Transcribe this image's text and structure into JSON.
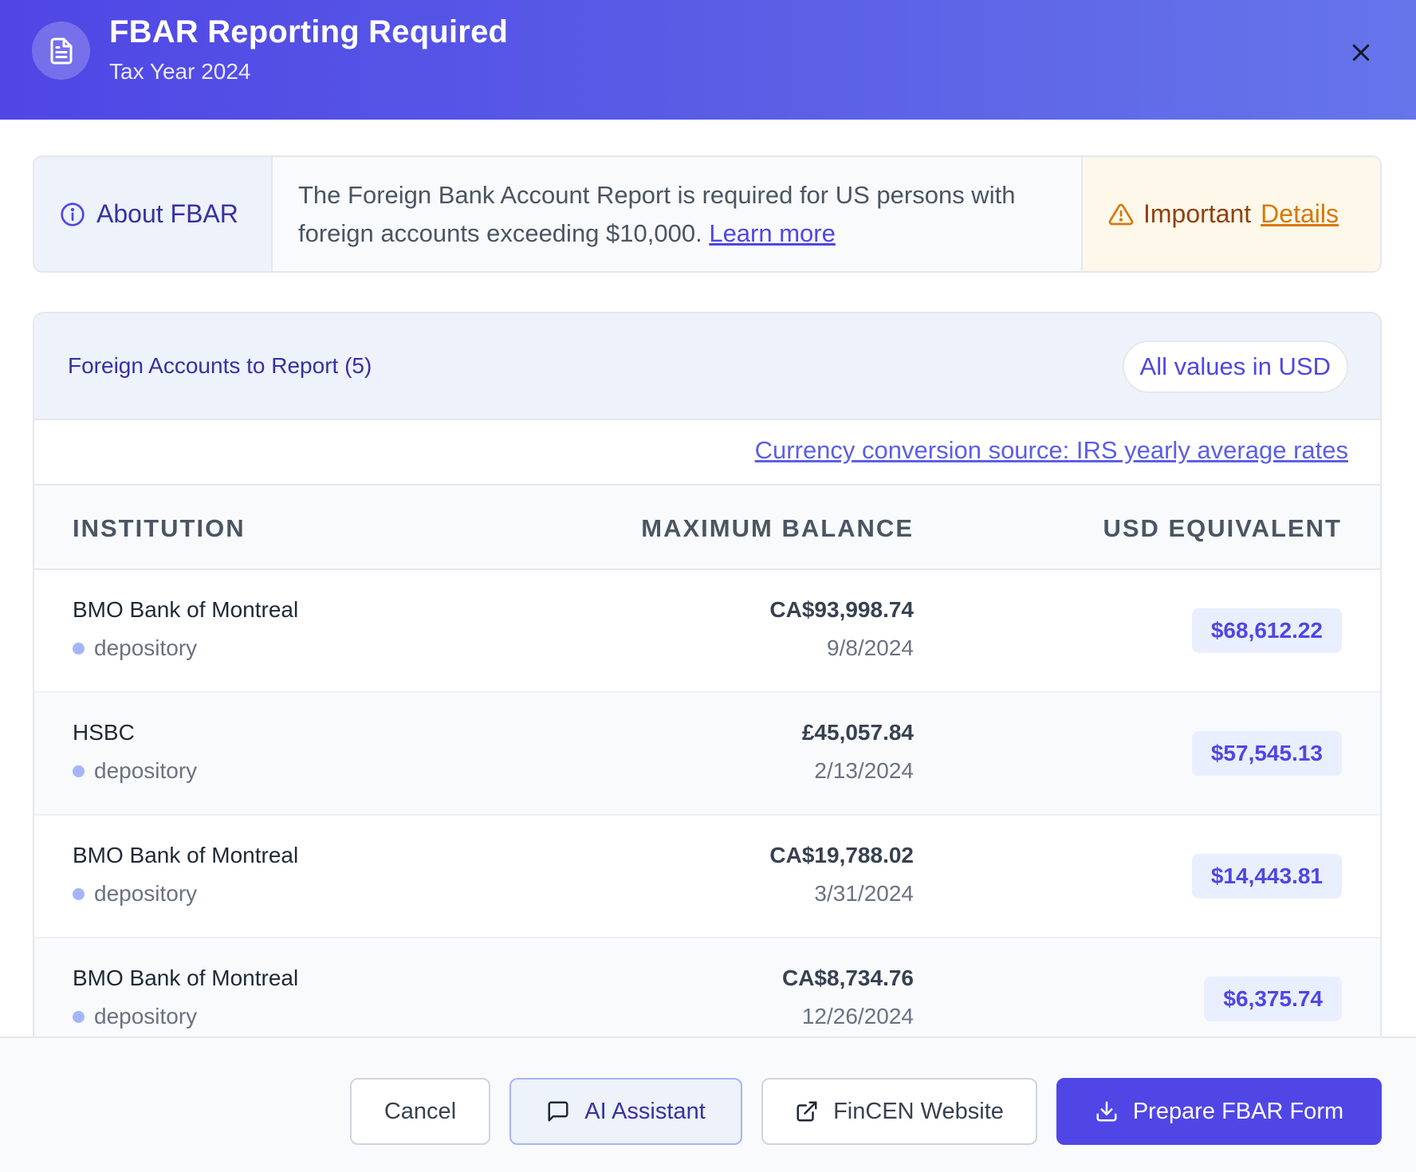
{
  "header": {
    "title": "FBAR Reporting Required",
    "subtitle": "Tax Year 2024",
    "icon": "document-icon",
    "close_icon": "close-icon"
  },
  "info": {
    "about_label": "About FBAR",
    "description": "The Foreign Bank Account Report is required for US persons with foreign accounts exceeding $10,000.",
    "learn_more": "Learn more",
    "important_label": "Important",
    "details_link": "Details"
  },
  "accounts": {
    "title": "Foreign Accounts to Report (5)",
    "values_pill": "All values in USD",
    "conversion_link": "Currency conversion source: IRS yearly average rates",
    "columns": {
      "institution": "INSTITUTION",
      "maximum_balance": "MAXIMUM BALANCE",
      "usd_equivalent": "USD EQUIVALENT"
    },
    "rows": [
      {
        "institution": "BMO Bank of Montreal",
        "type": "depository",
        "max_balance": "CA$93,998.74",
        "date": "9/8/2024",
        "usd": "$68,612.22"
      },
      {
        "institution": "HSBC",
        "type": "depository",
        "max_balance": "£45,057.84",
        "date": "2/13/2024",
        "usd": "$57,545.13"
      },
      {
        "institution": "BMO Bank of Montreal",
        "type": "depository",
        "max_balance": "CA$19,788.02",
        "date": "3/31/2024",
        "usd": "$14,443.81"
      },
      {
        "institution": "BMO Bank of Montreal",
        "type": "depository",
        "max_balance": "CA$8,734.76",
        "date": "12/26/2024",
        "usd": "$6,375.74"
      }
    ]
  },
  "footer": {
    "cancel": "Cancel",
    "ai_assistant": "AI Assistant",
    "fincen_website": "FinCEN Website",
    "prepare": "Prepare FBAR Form"
  },
  "colors": {
    "primary": "#4f46e5",
    "header_gradient_end": "#6675ea",
    "warning_text": "#92400e",
    "warning_link": "#d97706",
    "warning_bg": "#fdf8ea",
    "badge_bg": "#eaefff"
  }
}
